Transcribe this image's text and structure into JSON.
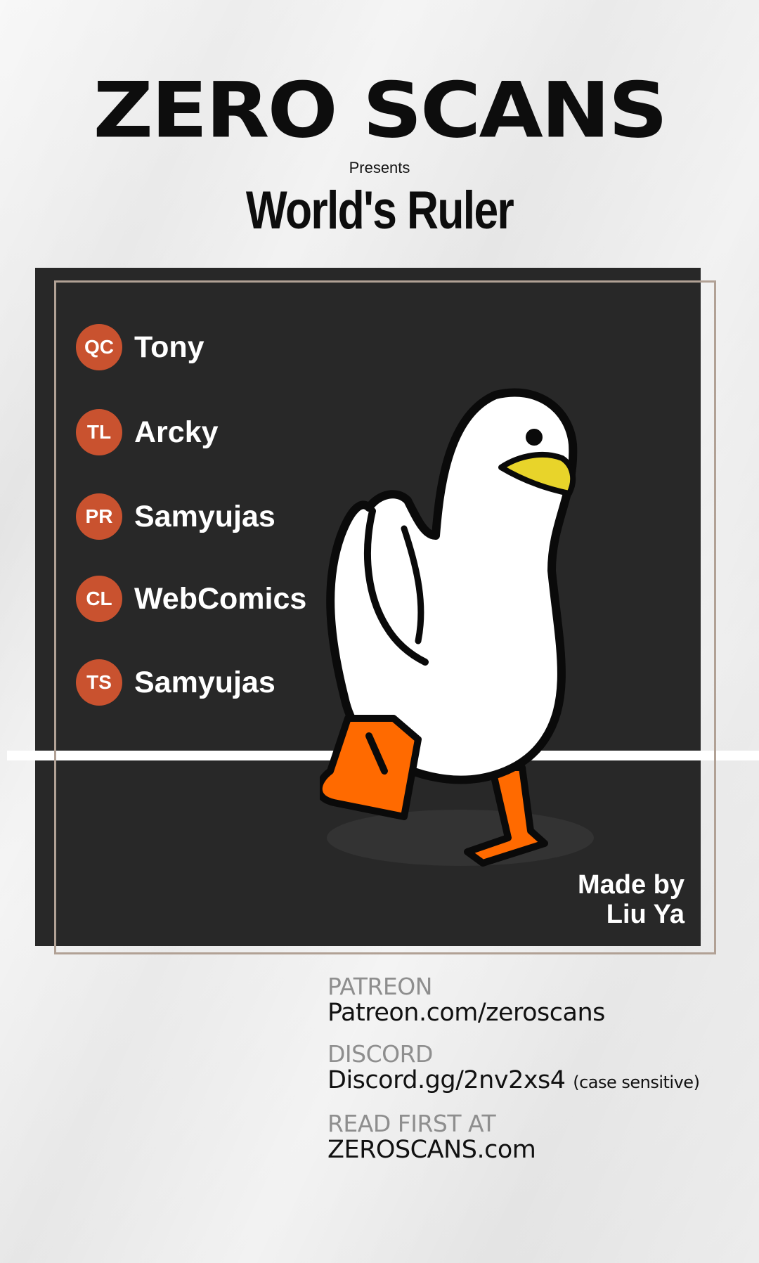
{
  "header": {
    "brand": "ZERO SCANS",
    "presents": "Presents",
    "series_title": "World's Ruler"
  },
  "credits": [
    {
      "role": "QC",
      "name": "Tony"
    },
    {
      "role": "TL",
      "name": "Arcky"
    },
    {
      "role": "PR",
      "name": "Samyujas"
    },
    {
      "role": "CL",
      "name": "WebComics"
    },
    {
      "role": "TS",
      "name": "Samyujas"
    }
  ],
  "made_by": {
    "line1": "Made by",
    "line2": "Liu Ya"
  },
  "links": [
    {
      "label": "PATREON",
      "value": "Patreon.com/zeroscans",
      "note": ""
    },
    {
      "label": "DISCORD",
      "value": "Discord.gg/2nv2xs4",
      "note": "(case sensitive)"
    },
    {
      "label": "READ FIRST AT",
      "value": "ZEROSCANS.com",
      "note": ""
    }
  ],
  "colors": {
    "badge": "#c9522f",
    "card": "#282828",
    "frame": "#b1a195",
    "duck_feet": "#ff6a00",
    "duck_beak": "#e8d42a"
  },
  "icons": {
    "mascot": "duck-illustration"
  }
}
